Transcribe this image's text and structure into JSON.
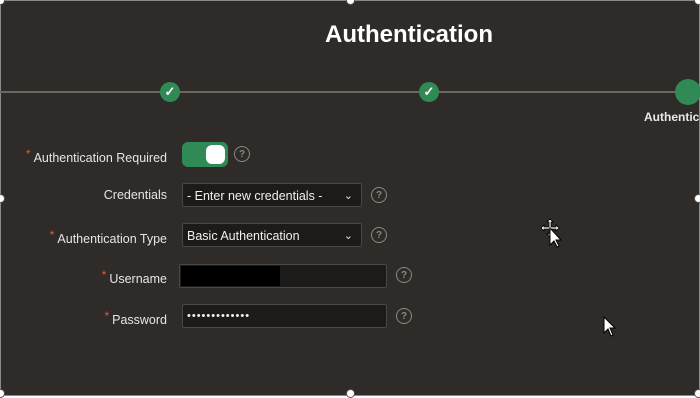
{
  "title": "Authentication",
  "wizard": {
    "current_step_label": "Authenticatio",
    "done_icon": "check-icon"
  },
  "form": {
    "auth_required": {
      "label": "Authentication Required",
      "required": true,
      "value": true
    },
    "credentials": {
      "label": "Credentials",
      "required": false,
      "value": "- Enter new credentials -"
    },
    "auth_type": {
      "label": "Authentication Type",
      "required": true,
      "value": "Basic Authentication"
    },
    "username": {
      "label": "Username",
      "required": true,
      "value": ""
    },
    "password": {
      "label": "Password",
      "required": true,
      "value": "•••••••••••••"
    }
  },
  "colors": {
    "background": "#2e2b28",
    "accent": "#2f8a55",
    "required_marker": "#e05a44"
  }
}
